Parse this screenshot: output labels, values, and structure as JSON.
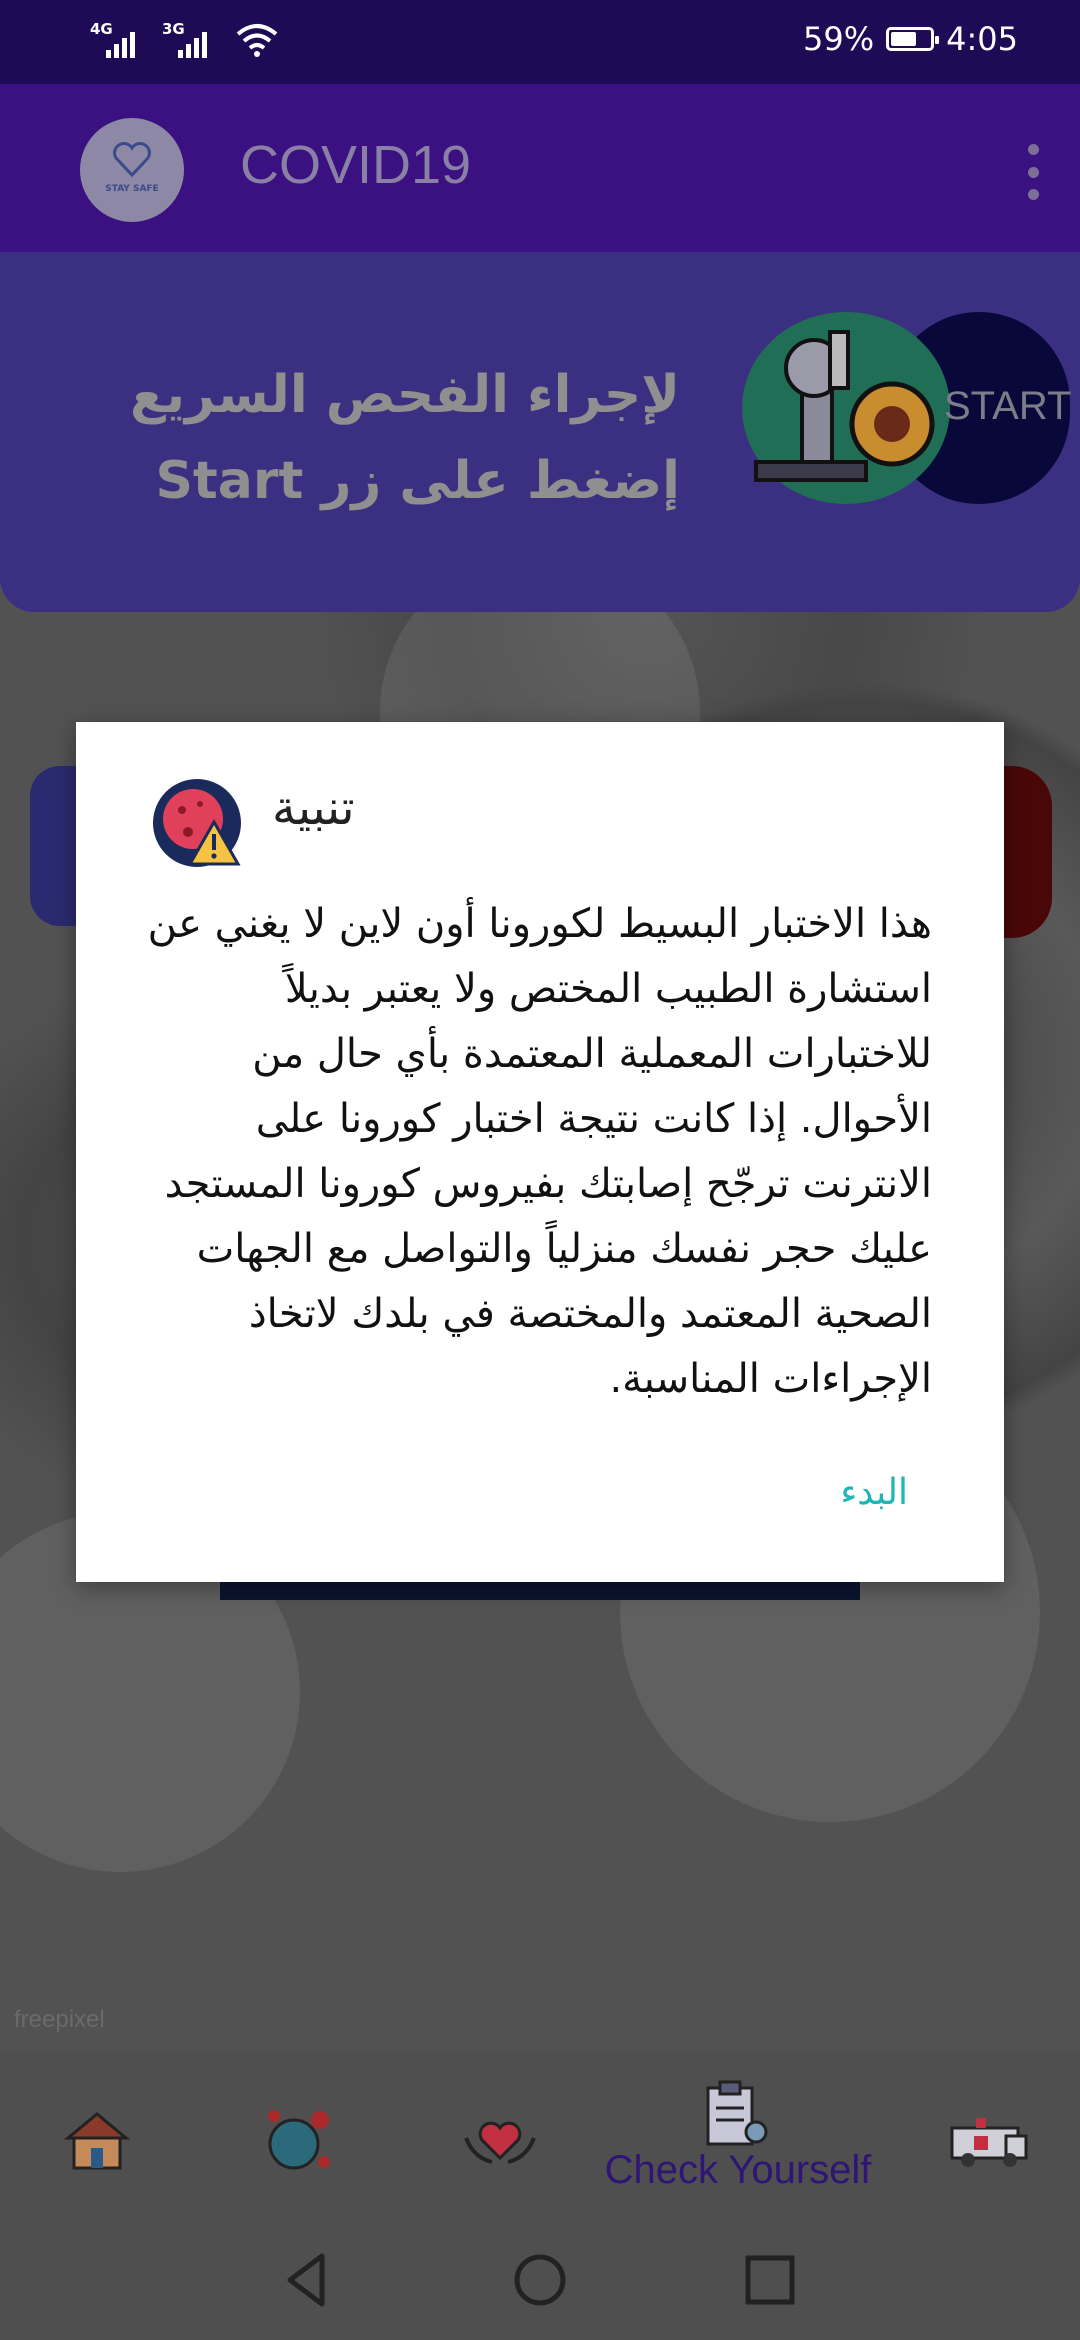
{
  "status_bar": {
    "network1": "4G",
    "network2": "3G",
    "battery": "59%",
    "time": "4:05"
  },
  "app_bar": {
    "logo_text": "STAY SAFE",
    "title": "COVID19"
  },
  "hero": {
    "text": "لإجراء الفحص السريع إضغط على زر Start",
    "start_label": "START"
  },
  "watermark": "freepixel",
  "bottom_nav": {
    "items": [
      {
        "icon": "house-icon"
      },
      {
        "icon": "virus-globe-icon"
      },
      {
        "icon": "heart-hands-icon"
      },
      {
        "icon": "clipboard-check-icon",
        "label": "Check Yourself",
        "selected": true
      },
      {
        "icon": "ambulance-icon"
      }
    ]
  },
  "dialog": {
    "title": "تنبية",
    "message": "هذا الاختبار البسيط لكورونا أون لاين لا يغني عن استشارة الطبيب المختص ولا يعتبر بديلاً للاختبارات المعملية المعتمدة بأي حال من الأحوال. إذا كانت نتيجة اختبار كورونا على الانترنت ترجّح إصابتك بفيروس كورونا المستجد عليك حجر نفسك منزلياً والتواصل مع الجهات الصحية المعتمد والمختصة في بلدك لاتخاذ الإجراءات المناسبة.",
    "button": "البدء",
    "icon": "virus-warning-icon"
  },
  "colors": {
    "status_bar": "#1e0a55",
    "app_bar": "#3b1080",
    "accent_button": "#1fb6b6",
    "nav_selected": "#2e1576"
  }
}
